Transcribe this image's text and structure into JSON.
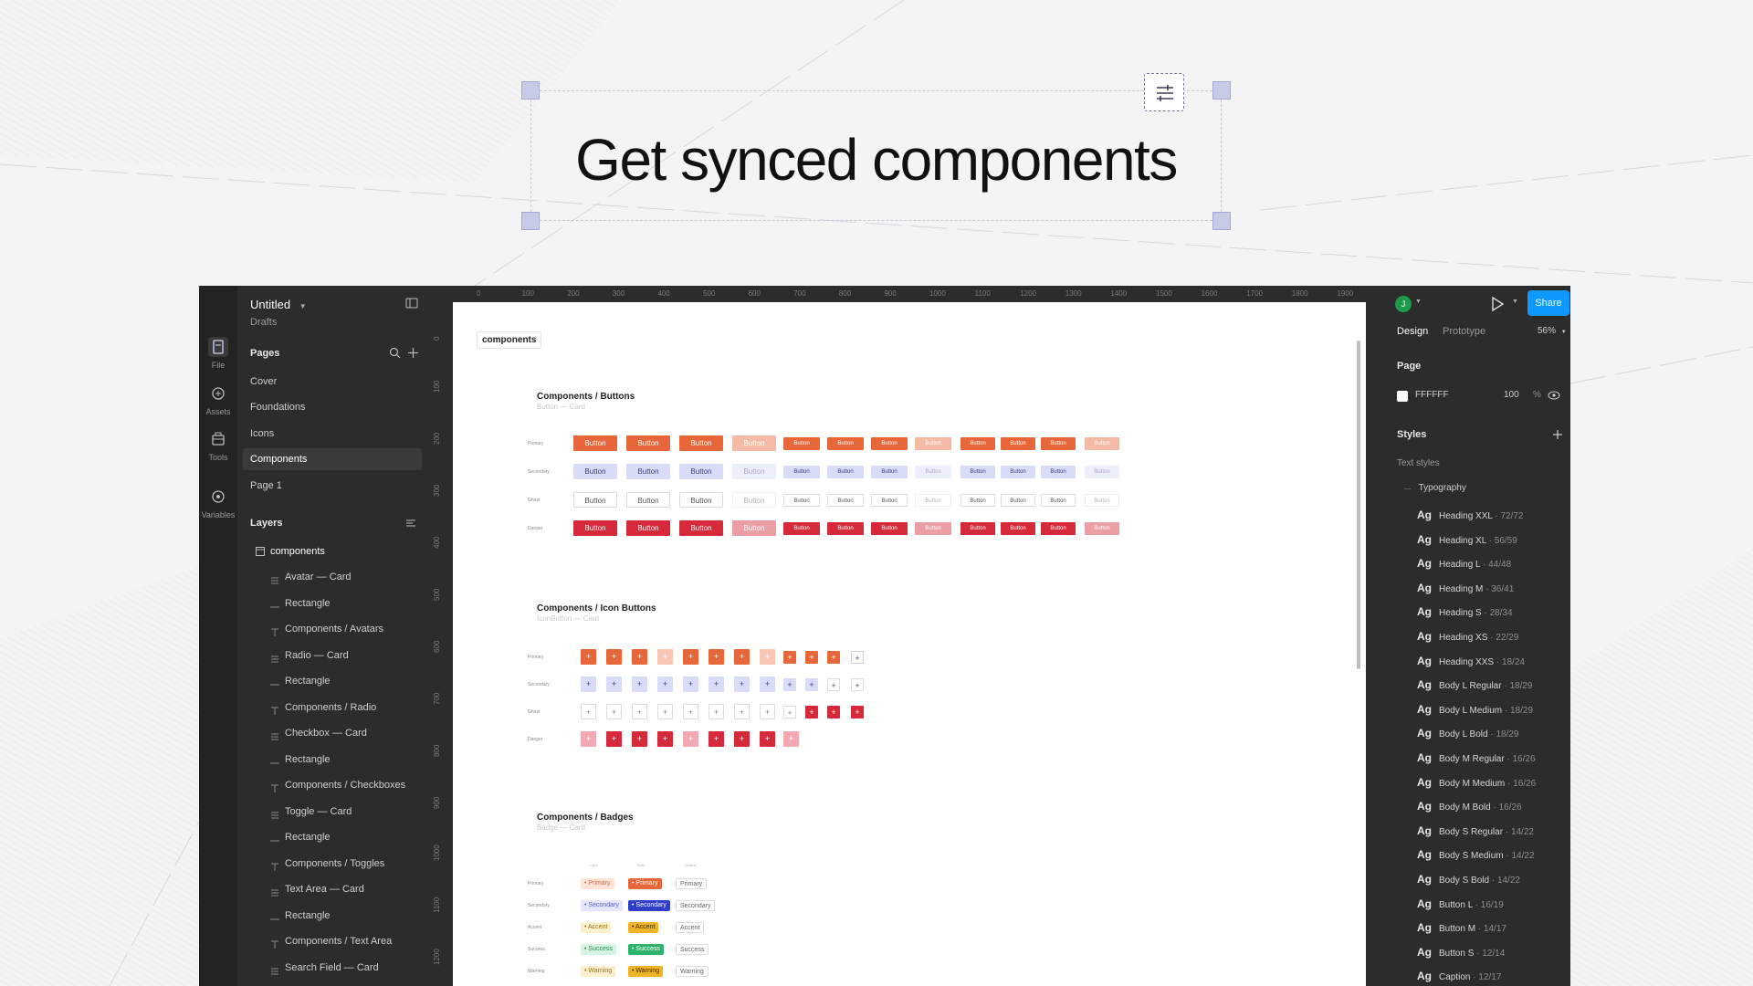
{
  "hero": {
    "heading": "Get synced components"
  },
  "file": {
    "name": "Untitled",
    "location": "Drafts"
  },
  "rail": [
    {
      "label": "File",
      "icon": "file-icon"
    },
    {
      "label": "Assets",
      "icon": "assets-icon"
    },
    {
      "label": "Tools",
      "icon": "tools-icon"
    },
    {
      "label": "Variables",
      "icon": "variables-icon"
    }
  ],
  "pages": {
    "title": "Pages",
    "items": [
      "Cover",
      "Foundations",
      "Icons",
      "Components",
      "Page 1"
    ],
    "selected": "Components"
  },
  "layers": {
    "title": "Layers",
    "root": "components",
    "items": [
      "Avatar — Card",
      "Rectangle",
      "Components / Avatars",
      "Radio — Card",
      "Rectangle",
      "Components / Radio",
      "Checkbox — Card",
      "Rectangle",
      "Components / Checkboxes",
      "Toggle — Card",
      "Rectangle",
      "Components / Toggles",
      "Text Area — Card",
      "Rectangle",
      "Components / Text Area",
      "Search Field — Card"
    ]
  },
  "ruler": {
    "top": [
      "0",
      "100",
      "200",
      "300",
      "400",
      "500",
      "600",
      "700",
      "800",
      "900",
      "1000",
      "1100",
      "1200",
      "1300",
      "1400",
      "1500",
      "1600",
      "1700",
      "1800",
      "1900"
    ],
    "left": [
      "0",
      "100",
      "200",
      "300",
      "400",
      "500",
      "600",
      "700",
      "800",
      "900",
      "1000",
      "1100",
      "1200"
    ]
  },
  "canvas": {
    "frame_name": "components",
    "sections": [
      {
        "title": "Components / Buttons",
        "subtitle": "Button — Card"
      },
      {
        "title": "Components / Icon Buttons",
        "subtitle": "IconButton — Card"
      },
      {
        "title": "Components / Badges",
        "subtitle": "Badge — Card"
      }
    ],
    "button_rows": [
      "Primary",
      "Secondary",
      "Ghost",
      "Danger"
    ],
    "button_label": "Button",
    "badge_rows": [
      "Primary",
      "Secondary",
      "Accent",
      "Success",
      "Warning"
    ],
    "badge_cols": [
      "Light",
      "Bold",
      "Outline"
    ]
  },
  "right_panel": {
    "avatar_initial": "J",
    "share_label": "Share",
    "tabs": [
      "Design",
      "Prototype"
    ],
    "zoom": "56%",
    "page_label": "Page",
    "page_color": "FFFFFF",
    "page_opacity": "100",
    "page_opacity_unit": "%",
    "styles_label": "Styles",
    "text_styles_label": "Text styles",
    "group": "Typography",
    "text_styles": [
      {
        "name": "Heading XXL",
        "size": "72/72"
      },
      {
        "name": "Heading XL",
        "size": "56/59"
      },
      {
        "name": "Heading L",
        "size": "44/48"
      },
      {
        "name": "Heading M",
        "size": "36/41"
      },
      {
        "name": "Heading S",
        "size": "28/34"
      },
      {
        "name": "Heading XS",
        "size": "22/29"
      },
      {
        "name": "Heading XXS",
        "size": "18/24"
      },
      {
        "name": "Body L Regular",
        "size": "18/29"
      },
      {
        "name": "Body L Medium",
        "size": "18/29"
      },
      {
        "name": "Body L Bold",
        "size": "18/29"
      },
      {
        "name": "Body M Regular",
        "size": "16/26"
      },
      {
        "name": "Body M Medium",
        "size": "16/26"
      },
      {
        "name": "Body M Bold",
        "size": "16/26"
      },
      {
        "name": "Body S Regular",
        "size": "14/22"
      },
      {
        "name": "Body S Medium",
        "size": "14/22"
      },
      {
        "name": "Body S Bold",
        "size": "14/22"
      },
      {
        "name": "Button L",
        "size": "16/19"
      },
      {
        "name": "Button M",
        "size": "14/17"
      },
      {
        "name": "Button S",
        "size": "12/14"
      },
      {
        "name": "Caption",
        "size": "12/17"
      }
    ]
  },
  "colors": {
    "accent": "#0d99ff",
    "primary": "#e8673a",
    "secondary": "#d9dcf7",
    "danger": "#d62a3a",
    "success": "#2fb36a",
    "warning": "#f0b429"
  }
}
